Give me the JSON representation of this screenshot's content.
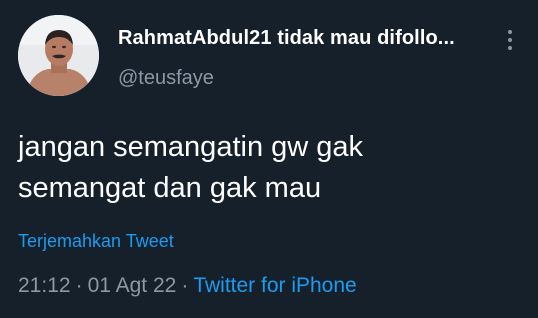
{
  "tweet": {
    "display_name": "RahmatAbdul21 tidak mau difollo...",
    "handle": "@teusfaye",
    "text": "jangan semangatin gw gak\nsemangat dan gak mau",
    "translate_label": "Terjemahkan Tweet",
    "time": "21:12",
    "separator": "·",
    "date": "01 Agt 22",
    "source": "Twitter for iPhone"
  },
  "icons": {
    "more": "more-vertical-icon",
    "avatar": "avatar"
  },
  "colors": {
    "background": "#15202b",
    "primary_text": "#ffffff",
    "secondary_text": "#8b98a5",
    "accent": "#1d9bf0"
  }
}
